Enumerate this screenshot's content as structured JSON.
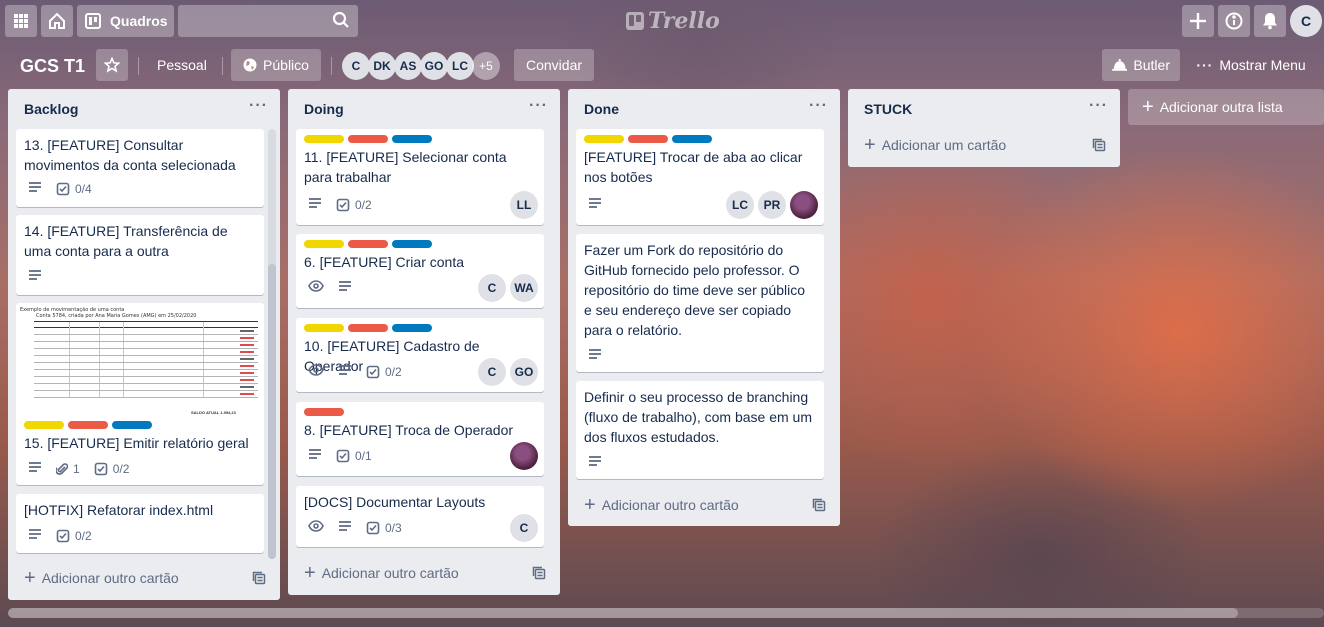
{
  "header": {
    "boards_label": "Quadros",
    "logo_text": "Trello",
    "user_initial": "C"
  },
  "board": {
    "title": "GCS T1",
    "team": "Pessoal",
    "visibility": "Público",
    "members": [
      "C",
      "DK",
      "AS",
      "GO",
      "LC"
    ],
    "more_members": "+5",
    "invite_label": "Convidar",
    "butler_label": "Butler",
    "menu_label": "Mostrar Menu"
  },
  "lists": {
    "backlog": {
      "title": "Backlog",
      "add_card": "Adicionar outro cartão",
      "cards": [
        {
          "title": "13. [FEATURE] Consultar movimentos da conta selecionada",
          "checklist": "0/4"
        },
        {
          "title": "14. [FEATURE] Transferência de uma conta para a outra"
        },
        {
          "title": "15. [FEATURE] Emitir relatório geral",
          "attachments": "1",
          "checklist": "0/2",
          "cover_caption": "Exemplo de movimentação de uma conta",
          "cover_caption2": "Conta 5784, criada por Ana Maria Gomes (AMG) em 25/02/2020",
          "cover_total": "SALDO ATUAL    1.994,23"
        },
        {
          "title": "[HOTFIX] Refatorar index.html",
          "checklist": "0/2"
        }
      ]
    },
    "doing": {
      "title": "Doing",
      "add_card": "Adicionar outro cartão",
      "cards": [
        {
          "title": "11. [FEATURE] Selecionar conta para trabalhar",
          "checklist": "0/2",
          "members": [
            "LL"
          ]
        },
        {
          "title": "6. [FEATURE] Criar conta",
          "members": [
            "C",
            "WA"
          ]
        },
        {
          "title": "10. [FEATURE] Cadastro de Operador",
          "checklist": "0/2",
          "members": [
            "C",
            "GO"
          ]
        },
        {
          "title": "8. [FEATURE] Troca de Operador",
          "checklist": "0/1"
        },
        {
          "title": "[DOCS] Documentar Layouts",
          "checklist": "0/3",
          "members": [
            "C"
          ]
        }
      ]
    },
    "done": {
      "title": "Done",
      "add_card": "Adicionar outro cartão",
      "cards": [
        {
          "title": "[FEATURE] Trocar de aba ao clicar nos botões",
          "members": [
            "LC",
            "PR"
          ]
        },
        {
          "title": "Fazer um Fork do repositório do GitHub fornecido pelo professor. O repositório do time deve ser público e seu endereço deve ser copiado para o relatório."
        },
        {
          "title": "Definir o seu processo de branching (fluxo de trabalho), com base em um dos fluxos estudados."
        }
      ]
    },
    "stuck": {
      "title": "STUCK",
      "add_card": "Adicionar um cartão"
    }
  },
  "add_list_label": "Adicionar outra lista"
}
